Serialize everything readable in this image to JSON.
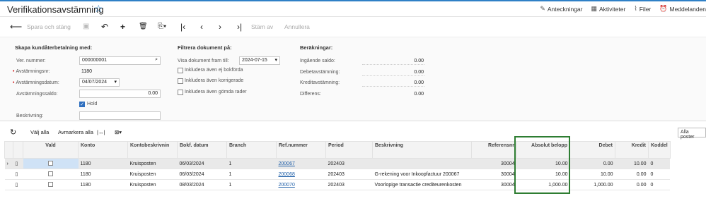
{
  "header": {
    "title": "Verifikationsavstämning",
    "links": [
      "Anteckningar",
      "Aktiviteter",
      "Filer",
      "Meddelanden"
    ]
  },
  "toolbar": {
    "save_close": "Spara och stäng",
    "approve": "Stäm av",
    "cancel": "Annullera"
  },
  "form": {
    "create_section": "Skapa kundåterbetalning med:",
    "ver_number_label": "Ver. nummer:",
    "ver_number_value": "000000001",
    "recon_no_label": "Avstämningsnr:",
    "recon_no_value": "1180",
    "recon_date_label": "Avstämningsdatum:",
    "recon_date_value": "04/07/2024",
    "recon_balance_label": "Avstämningssaldo:",
    "recon_balance_value": "0.00",
    "hold_label": "Hold",
    "description_label": "Beskrivning:",
    "filter_section": "Filtrera dokument på:",
    "show_until_label": "Visa dokument fram till:",
    "show_until_value": "2024-07-15",
    "include_unposted": "Inkludera även ej bokförda",
    "include_corrected": "Inkludera även korrigerade",
    "include_hidden": "Inkludera även gömda rader",
    "calc_section": "Beräkningar:",
    "opening_label": "Ingående saldo:",
    "opening_value": "0.00",
    "debit_label": "Debetavstämning:",
    "debit_value": "0.00",
    "credit_label": "Kreditavstämning:",
    "credit_value": "0.00",
    "diff_label": "Differens:",
    "diff_value": "0.00"
  },
  "gridbar": {
    "select_all": "Välj alla",
    "deselect_all": "Avmarkera alla",
    "filter_value": "Alla poster"
  },
  "table": {
    "headers": [
      "Vald",
      "Konto",
      "Kontobeskrivnin",
      "Bokf. datum",
      "Branch",
      "Ref.nummer",
      "Period",
      "Beskrivning",
      "Referensnr",
      "Absolut belopp",
      "Debet",
      "Kredit",
      "Koddel"
    ],
    "rows": [
      {
        "konto": "1180",
        "kontobeskr": "Kruisposten",
        "datum": "06/03/2024",
        "branch": "1",
        "ref": "200067",
        "period": "202403",
        "beskr": "",
        "refnr": "30004",
        "abs": "10.00",
        "debet": "0.00",
        "kredit": "10.00",
        "koddel": "0"
      },
      {
        "konto": "1180",
        "kontobeskr": "Kruisposten",
        "datum": "06/03/2024",
        "branch": "1",
        "ref": "200068",
        "period": "202403",
        "beskr": "G-rekening voor Inkoopfactuur 200067",
        "refnr": "30004",
        "abs": "10.00",
        "debet": "10.00",
        "kredit": "0.00",
        "koddel": "0"
      },
      {
        "konto": "1180",
        "kontobeskr": "Kruisposten",
        "datum": "08/03/2024",
        "branch": "1",
        "ref": "200070",
        "period": "202403",
        "beskr": "Voorlopige transactie crediteurenkosten",
        "refnr": "30004",
        "abs": "1,000.00",
        "debet": "1,000.00",
        "kredit": "0.00",
        "koddel": "0"
      }
    ]
  }
}
